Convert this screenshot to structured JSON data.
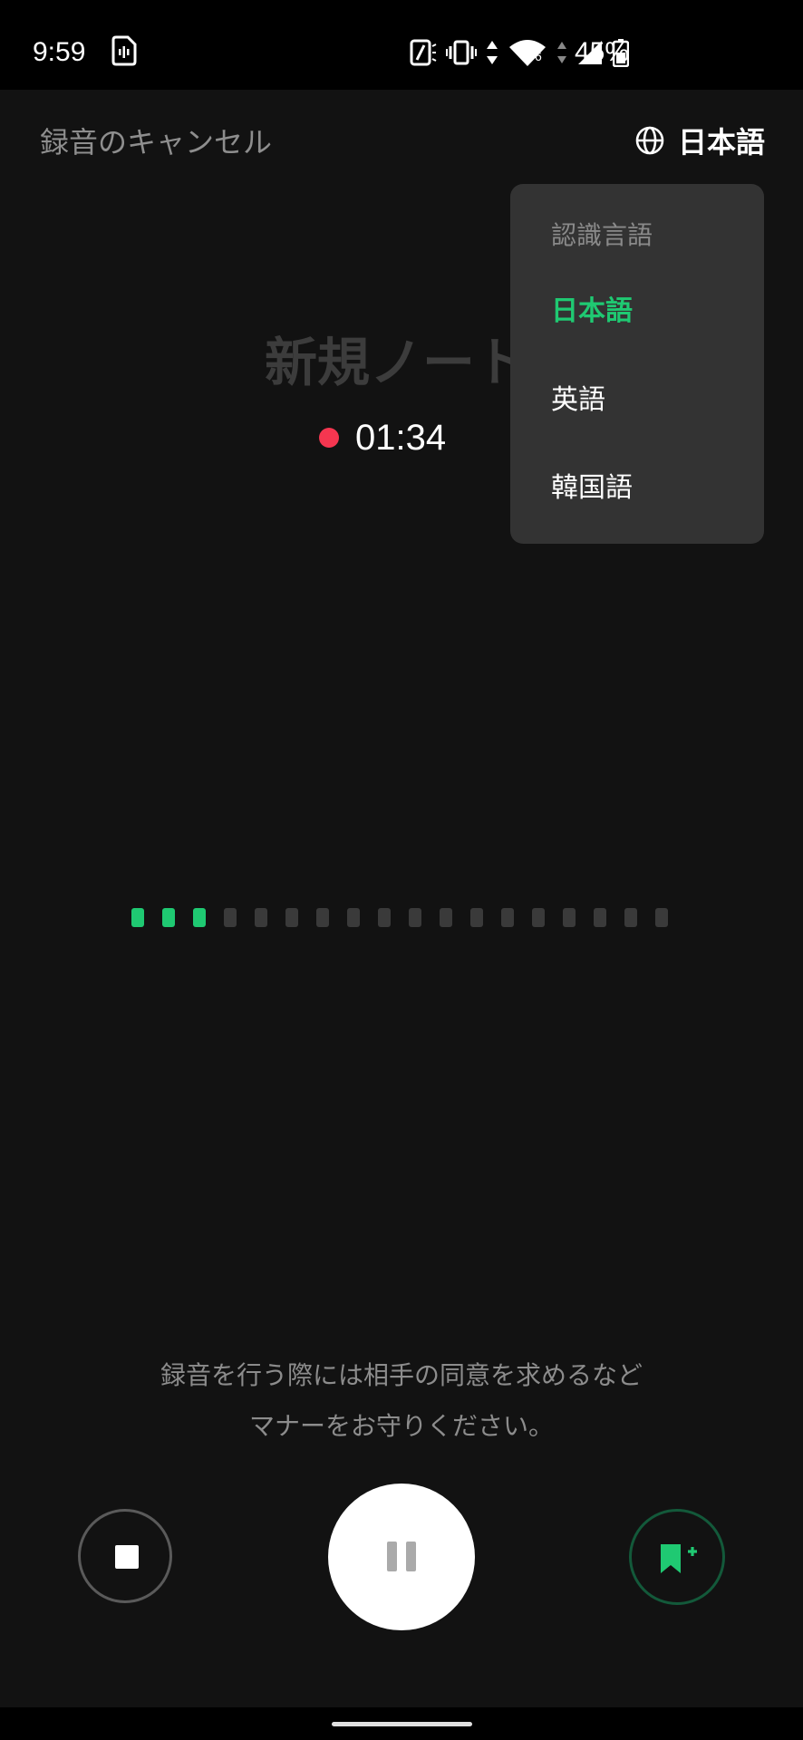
{
  "status_bar": {
    "time": "9:59",
    "battery_percent": "45%",
    "network_label": "6",
    "icons": [
      "voice-recorder-notification-icon",
      "nfc-icon",
      "vibrate-icon",
      "data-arrows-icon",
      "wifi-icon",
      "cell-signal-icon",
      "battery-icon"
    ]
  },
  "header": {
    "cancel_label": "録音のキャンセル",
    "language_label": "日本語",
    "language_icon": "globe-icon"
  },
  "recording": {
    "title": "新規ノート",
    "elapsed": "01:34",
    "status_color": "#f53650"
  },
  "language_menu": {
    "header": "認識言語",
    "options": [
      {
        "label": "日本語",
        "selected": true
      },
      {
        "label": "英語",
        "selected": false
      },
      {
        "label": "韓国語",
        "selected": false
      }
    ]
  },
  "level_meter": {
    "total_bars": 18,
    "active_bars": 3,
    "active_color": "#1fc972",
    "inactive_color": "#3a3a3a"
  },
  "notice": {
    "line1": "録音を行う際には相手の同意を求めるなど",
    "line2": "マナーをお守りください。"
  },
  "controls": {
    "stop_icon": "stop-icon",
    "pause_icon": "pause-icon",
    "bookmark_icon": "bookmark-add-icon"
  },
  "colors": {
    "accent": "#1fc972",
    "background": "#121212",
    "menu_background": "#333333"
  }
}
